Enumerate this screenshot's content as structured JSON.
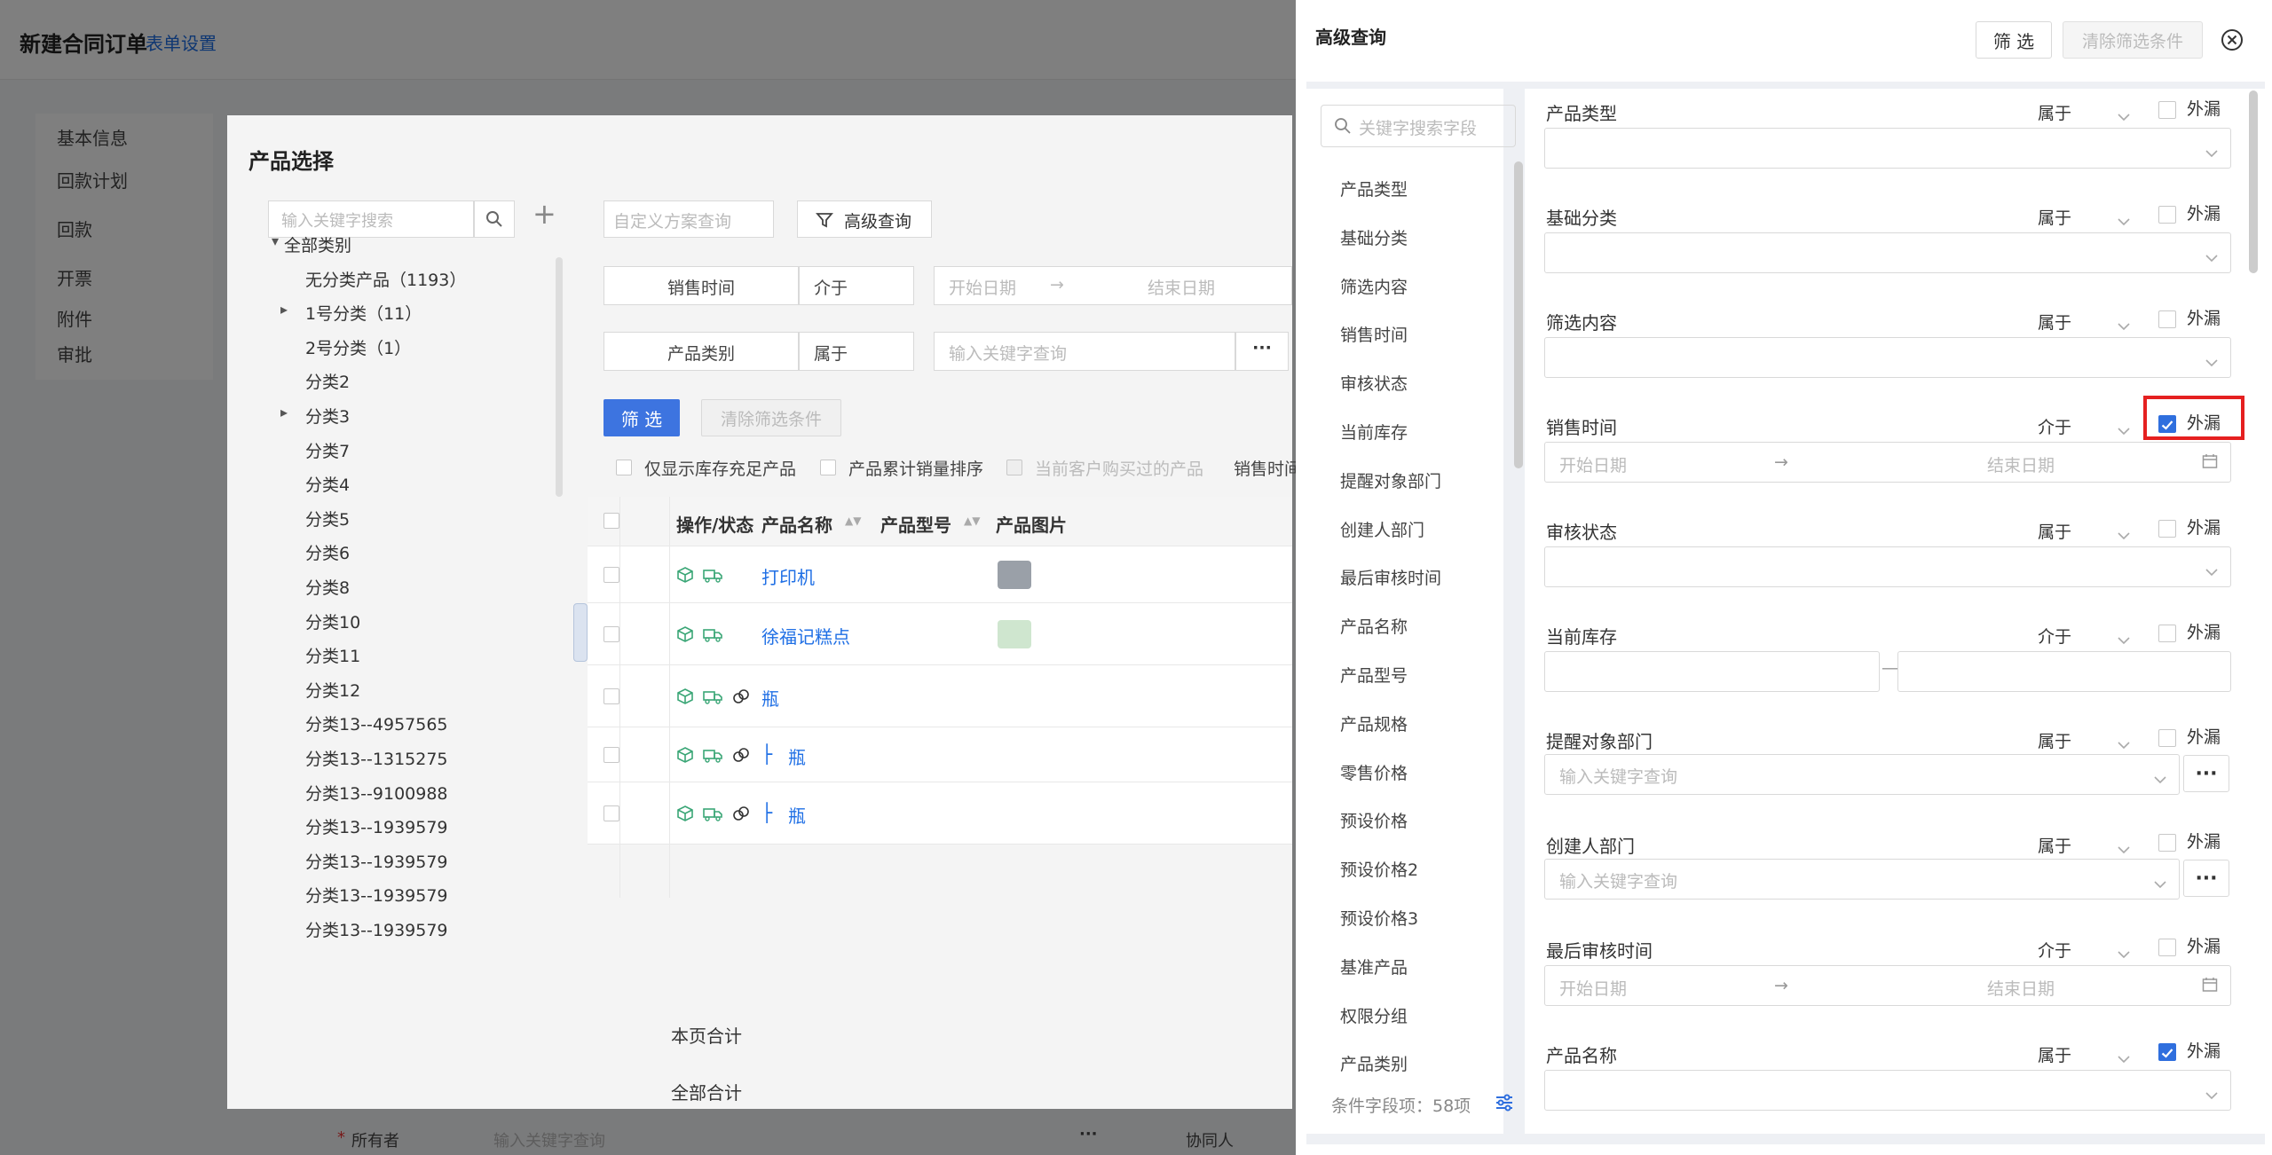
{
  "base_page": {
    "title": "新建合同订单",
    "form_setting": "表单设置",
    "nav_items": [
      "基本信息",
      "回款计划",
      "回款",
      "开票",
      "附件",
      "审批"
    ],
    "footer_owner_label": "所有者",
    "footer_owner_placeholder": "输入关键字查询",
    "footer_more": "···",
    "footer_collab_label": "协同人"
  },
  "product_modal": {
    "title": "产品选择",
    "tree_search_placeholder": "输入关键字搜索",
    "tree_add": "+",
    "tree": [
      {
        "label": "全部类别",
        "level": 0,
        "arrow": "down"
      },
      {
        "label": "无分类产品（1193）",
        "level": 1,
        "arrow": ""
      },
      {
        "label": "1号分类（11）",
        "level": 1,
        "arrow": "right"
      },
      {
        "label": "2号分类（1）",
        "level": 1,
        "arrow": ""
      },
      {
        "label": "分类2",
        "level": 1,
        "arrow": ""
      },
      {
        "label": "分类3",
        "level": 1,
        "arrow": "right"
      },
      {
        "label": "分类7",
        "level": 1,
        "arrow": ""
      },
      {
        "label": "分类4",
        "level": 1,
        "arrow": ""
      },
      {
        "label": "分类5",
        "level": 1,
        "arrow": ""
      },
      {
        "label": "分类6",
        "level": 1,
        "arrow": ""
      },
      {
        "label": "分类8",
        "level": 1,
        "arrow": ""
      },
      {
        "label": "分类10",
        "level": 1,
        "arrow": ""
      },
      {
        "label": "分类11",
        "level": 1,
        "arrow": ""
      },
      {
        "label": "分类12",
        "level": 1,
        "arrow": ""
      },
      {
        "label": "分类13--4957565",
        "level": 1,
        "arrow": ""
      },
      {
        "label": "分类13--1315275",
        "level": 1,
        "arrow": ""
      },
      {
        "label": "分类13--9100988",
        "level": 1,
        "arrow": ""
      },
      {
        "label": "分类13--1939579",
        "level": 1,
        "arrow": ""
      },
      {
        "label": "分类13--1939579",
        "level": 1,
        "arrow": ""
      },
      {
        "label": "分类13--1939579",
        "level": 1,
        "arrow": ""
      },
      {
        "label": "分类13--1939579",
        "level": 1,
        "arrow": ""
      }
    ],
    "scheme_select_placeholder": "自定义方案查询",
    "advanced_query_button": "高级查询",
    "filter_rows": [
      {
        "label": "销售时间",
        "operator": "介于",
        "start_placeholder": "开始日期",
        "arrow": "→",
        "end_placeholder": "结束日期"
      },
      {
        "label": "产品类别",
        "operator": "属于",
        "input_placeholder": "输入关键字查询",
        "more": "···"
      }
    ],
    "filter_button": "筛 选",
    "clear_button": "清除筛选条件",
    "options": [
      "仅显示库存充足产品",
      "产品累计销量排序",
      "当前客户购买过的产品",
      "销售时间"
    ],
    "table": {
      "columns": [
        "操作/状态",
        "产品名称",
        "产品型号",
        "产品图片"
      ],
      "rows": [
        {
          "name": "打印机",
          "prefix": ""
        },
        {
          "name": "徐福记糕点",
          "prefix": ""
        },
        {
          "name": "瓶",
          "prefix": ""
        },
        {
          "name": "瓶",
          "prefix": "├"
        },
        {
          "name": "瓶",
          "prefix": "├"
        }
      ],
      "page_total_label": "本页合计",
      "all_total_label": "全部合计"
    }
  },
  "advanced_query": {
    "title": "高级查询",
    "filter_button": "筛 选",
    "clear_button": "清除筛选条件",
    "field_search_placeholder": "关键字搜索字段",
    "field_list": [
      "产品类型",
      "基础分类",
      "筛选内容",
      "销售时间",
      "审核状态",
      "当前库存",
      "提醒对象部门",
      "创建人部门",
      "最后审核时间",
      "产品名称",
      "产品型号",
      "产品规格",
      "零售价格",
      "预设价格",
      "预设价格2",
      "预设价格3",
      "基准产品",
      "权限分组",
      "产品类别"
    ],
    "field_count_label": "条件字段项：58项",
    "exclude_label": "外漏",
    "date_start_placeholder": "开始日期",
    "date_end_placeholder": "结束日期",
    "date_arrow": "→",
    "keyword_placeholder": "输入关键字查询",
    "more_button": "···",
    "range_sep": "—",
    "conditions": [
      {
        "label": "产品类型",
        "operator": "属于",
        "exclude_checked": false,
        "kind": "select"
      },
      {
        "label": "基础分类",
        "operator": "属于",
        "exclude_checked": false,
        "kind": "select"
      },
      {
        "label": "筛选内容",
        "operator": "属于",
        "exclude_checked": false,
        "kind": "select"
      },
      {
        "label": "销售时间",
        "operator": "介于",
        "exclude_checked": true,
        "kind": "date"
      },
      {
        "label": "审核状态",
        "operator": "属于",
        "exclude_checked": false,
        "kind": "select"
      },
      {
        "label": "当前库存",
        "operator": "介于",
        "exclude_checked": false,
        "kind": "range"
      },
      {
        "label": "提醒对象部门",
        "operator": "属于",
        "exclude_checked": false,
        "kind": "keyword"
      },
      {
        "label": "创建人部门",
        "operator": "属于",
        "exclude_checked": false,
        "kind": "keyword"
      },
      {
        "label": "最后审核时间",
        "operator": "介于",
        "exclude_checked": false,
        "kind": "date"
      },
      {
        "label": "产品名称",
        "operator": "属于",
        "exclude_checked": true,
        "kind": "select"
      }
    ]
  },
  "colors": {
    "primary": "#3d74e0",
    "link": "#1f6fe5",
    "checkbox_checked": "#2f6fde",
    "highlight": "#e52020",
    "status_green": "#3aa676"
  }
}
